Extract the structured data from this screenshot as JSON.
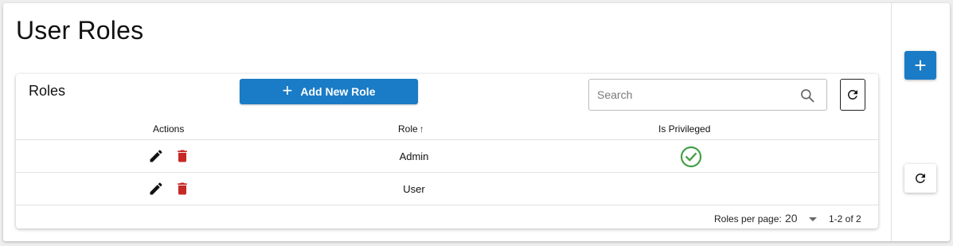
{
  "page": {
    "title": "User Roles"
  },
  "table": {
    "title": "Roles",
    "add_button_label": "Add New Role",
    "search_placeholder": "Search",
    "columns": {
      "actions": "Actions",
      "role": "Role",
      "is_privileged": "Is Privileged"
    },
    "sort": {
      "column": "Role",
      "direction": "ascending"
    },
    "rows": [
      {
        "role": "Admin",
        "is_privileged": true
      },
      {
        "role": "User",
        "is_privileged": false
      }
    ],
    "footer": {
      "rows_per_page_label": "Roles per page:",
      "rows_per_page_value": "20",
      "range_label": "1-2 of 2"
    }
  },
  "icons": {
    "edit": "pencil-icon",
    "delete": "trash-icon",
    "privileged": "check-circle-icon",
    "search": "magnifier-icon",
    "refresh": "refresh-icon",
    "add": "plus-icon"
  },
  "colors": {
    "primary": "#1a7bc6",
    "danger": "#c62828",
    "success": "#43a047"
  }
}
